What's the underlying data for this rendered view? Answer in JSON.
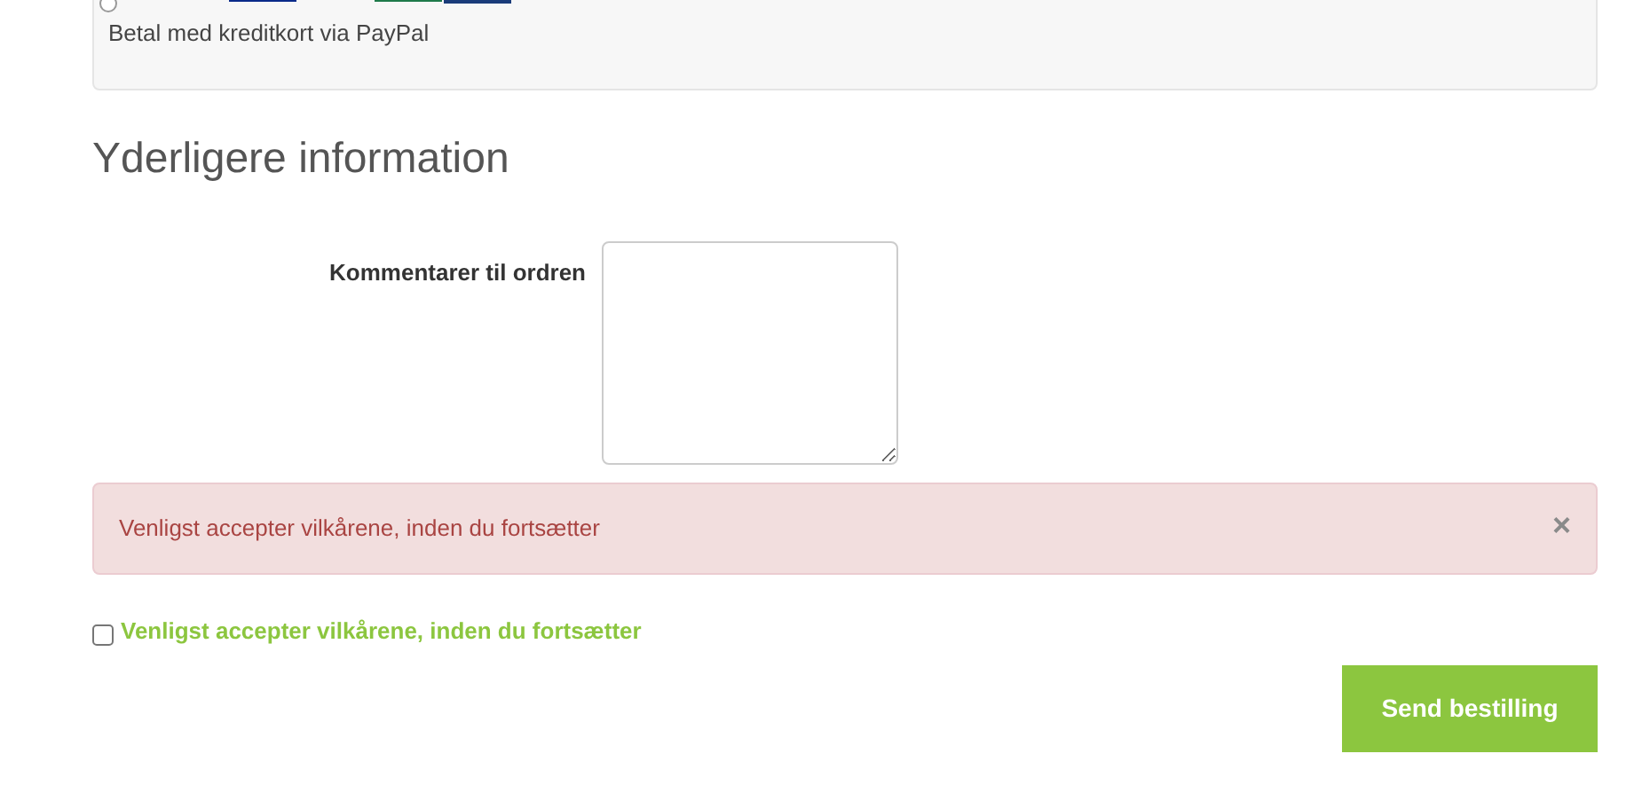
{
  "payment": {
    "text": "Betal med kreditkort via PayPal",
    "selected": false
  },
  "section_title": "Yderligere information",
  "comments": {
    "label": "Kommentarer til ordren"
  },
  "alert": {
    "message": "Venligst accepter vilkårene, inden du fortsætter",
    "close": "×"
  },
  "terms": {
    "label": "Venligst accepter vilkårene, inden du fortsætter",
    "checked": false
  },
  "submit": "Send bestilling"
}
